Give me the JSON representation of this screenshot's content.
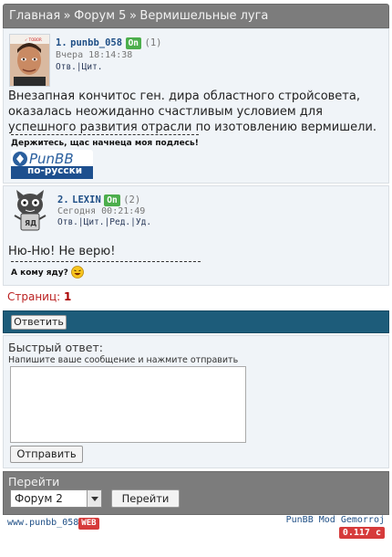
{
  "breadcrumb": {
    "items": [
      "Главная",
      "Форум 5",
      "Вермишельные луга"
    ],
    "separator": "»"
  },
  "posts": [
    {
      "number": "1.",
      "author": "punbb_058",
      "status": "On",
      "count": "(1)",
      "time": "Вчера 18:14:38",
      "actions": [
        "Отв.",
        "Цит."
      ],
      "message": "Внезапная кончитос ген. дира областного стройсовета, оказалась неожиданно счастливым условием для успешного развития отрасли по изотовлению вермишели.",
      "signature": "Держитесь, щас начнеца моя подлесь!",
      "logo_text": "по-русски"
    },
    {
      "number": "2.",
      "author": "LEXIN",
      "status": "On",
      "count": "(2)",
      "time": "Сегодня 00:21:49",
      "actions": [
        "Отв.",
        "Цит.",
        "Ред.",
        "Уд."
      ],
      "message": "Ню-Ню! Не верю!",
      "signature": "А кому яду?"
    }
  ],
  "pagination": {
    "label": "Страниц:",
    "current": "1"
  },
  "reply_button": "Ответить",
  "quick_reply": {
    "title": "Быстрый ответ:",
    "hint": "Напишите ваше сообщение и нажмите отправить",
    "value": "",
    "submit": "Отправить"
  },
  "jump": {
    "title": "Перейти",
    "selected": "Форум 2",
    "button": "Перейти"
  },
  "footer": {
    "site": "www.punbb_058",
    "web_badge": "WEB",
    "mod": "PunBB Mod Gemorroj",
    "timing": "0.117 c"
  },
  "colors": {
    "header_gray": "#7c7c7c",
    "reply_bar": "#1d5c7a",
    "online_green": "#4cae4c",
    "badge_red": "#d63b3b",
    "link_blue": "#1f4f86"
  },
  "icons": {
    "avatar1": "man-photo-avatar",
    "avatar2": "cat-cartoon-avatar",
    "smiley": "laughing-smiley-icon",
    "dropdown": "chevron-down-icon"
  }
}
